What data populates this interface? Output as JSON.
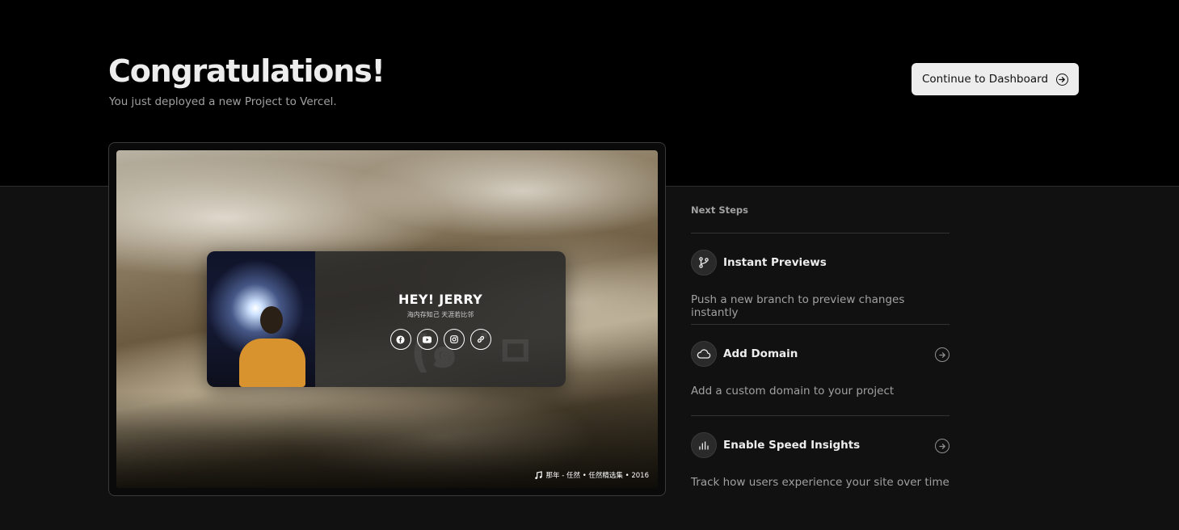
{
  "header": {
    "title": "Congratulations!",
    "subtitle": "You just deployed a new Project to Vercel.",
    "dashboard_button": "Continue to Dashboard"
  },
  "preview": {
    "name": "HEY! JERRY",
    "motto": "海内存知己 天涯若比邻",
    "kaomoji": "(๑ ˙ㅁ˙)",
    "social_icons": [
      "facebook-icon",
      "youtube-icon",
      "instagram-icon",
      "link-icon"
    ],
    "music": "那年 - 任然 • 任然精选集 • 2016"
  },
  "next_steps": {
    "label": "Next Steps",
    "items": [
      {
        "title": "Instant Previews",
        "desc": "Push a new branch to preview changes instantly",
        "icon": "git-branch-icon",
        "has_arrow": false
      },
      {
        "title": "Add Domain",
        "desc": "Add a custom domain to your project",
        "icon": "cloud-icon",
        "has_arrow": true
      },
      {
        "title": "Enable Speed Insights",
        "desc": "Track how users experience your site over time",
        "icon": "bar-chart-icon",
        "has_arrow": true
      }
    ]
  }
}
